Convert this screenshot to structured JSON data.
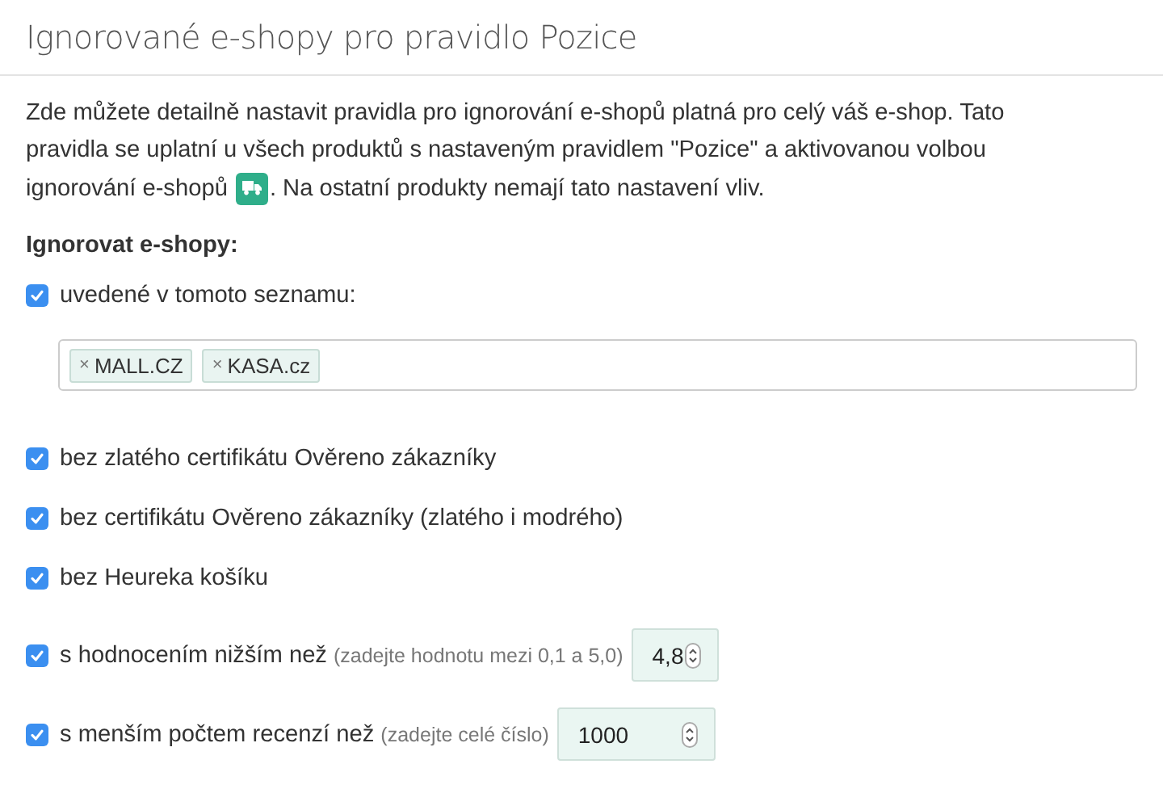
{
  "title": "Ignorované e-shopy pro pravidlo Pozice",
  "description": {
    "lines": [
      "Zde můžete detailně nastavit pravidla pro ignorování e-shopů platná pro celý váš e-shop. Tato",
      "pravidla se uplatní u všech produktů s nastaveným pravidlem \"Pozice\" a aktivovanou volbou"
    ],
    "before_icon": "ignorování e-shopů",
    "after_icon": ". Na ostatní produkty nemají tato nastavení vliv."
  },
  "section_label": "Ignorovat e-shopy:",
  "options": [
    {
      "kind": "tags",
      "label": "uvedené v tomoto seznamu:",
      "checked": true,
      "tags": [
        {
          "remove": "×",
          "label": "MALL.CZ"
        },
        {
          "remove": "×",
          "label": "KASA.cz"
        }
      ]
    },
    {
      "kind": "checkbox",
      "label": "bez zlatého certifikátu Ověreno zákazníky",
      "checked": true
    },
    {
      "kind": "checkbox",
      "label": "bez certifikátu Ověreno zákazníky (zlatého i modrého)",
      "checked": true
    },
    {
      "kind": "checkbox",
      "label": "bez Heureka košíku",
      "checked": true
    },
    {
      "kind": "number",
      "label": "s hodnocením nižším než",
      "hint": "(zadejte hodnotu mezi 0,1 a 5,0)",
      "value": "4,8",
      "checked": true
    },
    {
      "kind": "number",
      "label": "s menším počtem recenzí než",
      "hint": "(zadejte celé číslo)",
      "value": "1000",
      "checked": true
    }
  ]
}
